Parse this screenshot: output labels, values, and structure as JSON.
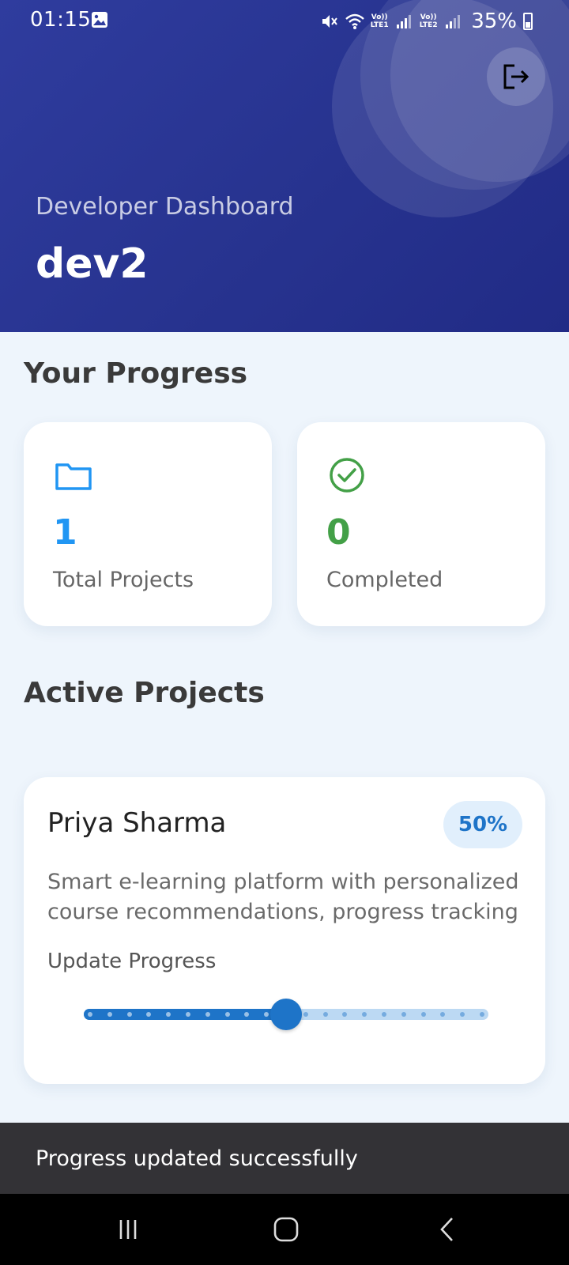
{
  "status_bar": {
    "time": "01:15",
    "lte1": "Vo))\nLTE1",
    "lte2": "Vo))\nLTE2",
    "battery": "35%"
  },
  "header": {
    "subtitle": "Developer Dashboard",
    "title": "dev2",
    "logout_icon": "logout-icon"
  },
  "progress_section": {
    "title": "Your Progress",
    "stats": [
      {
        "icon": "folder-icon",
        "value": "1",
        "label": "Total Projects",
        "color": "#2196f3"
      },
      {
        "icon": "check-circle-icon",
        "value": "0",
        "label": "Completed",
        "color": "#43a047"
      }
    ]
  },
  "active_section": {
    "title": "Active Projects",
    "projects": [
      {
        "name": "Priya Sharma",
        "percent": "50%",
        "description": "Smart e-learning platform with personalized course recommendations, progress tracking",
        "update_label": "Update Progress",
        "progress_value": 0.5,
        "divisions": 20
      }
    ]
  },
  "snackbar": {
    "message": "Progress updated successfully"
  },
  "colors": {
    "accent": "#1e74c8",
    "header": "#27338f",
    "success": "#43a047"
  }
}
